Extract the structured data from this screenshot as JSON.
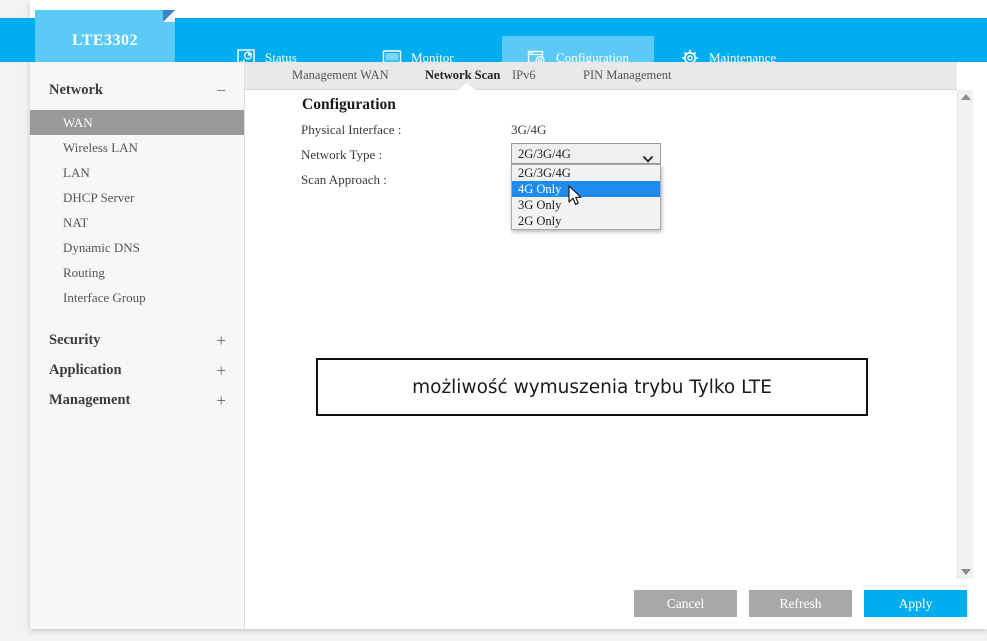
{
  "app": {
    "logo": "LTE3302"
  },
  "topnav": {
    "items": [
      {
        "label": "Status",
        "icon": "status-chart-icon",
        "active": false
      },
      {
        "label": "Monitor",
        "icon": "monitor-screen-icon",
        "active": false
      },
      {
        "label": "Configuration",
        "icon": "window-gear-icon",
        "active": true
      },
      {
        "label": "Maintenance",
        "icon": "gear-icon",
        "active": false
      }
    ]
  },
  "subtabs": {
    "items": [
      {
        "label": "Management WAN",
        "active": false
      },
      {
        "label": "Network Scan",
        "active": true
      },
      {
        "label": "IPv6",
        "active": false
      },
      {
        "label": "PIN Management",
        "active": false
      }
    ]
  },
  "sidebar": {
    "groups": [
      {
        "label": "Network",
        "toggle": "−"
      },
      {
        "label": "Security",
        "toggle": "+"
      },
      {
        "label": "Application",
        "toggle": "+"
      },
      {
        "label": "Management",
        "toggle": "+"
      }
    ],
    "network_items": [
      {
        "label": "WAN",
        "active": true
      },
      {
        "label": "Wireless LAN",
        "active": false
      },
      {
        "label": "LAN",
        "active": false
      },
      {
        "label": "DHCP Server",
        "active": false
      },
      {
        "label": "NAT",
        "active": false
      },
      {
        "label": "Dynamic DNS",
        "active": false
      },
      {
        "label": "Routing",
        "active": false
      },
      {
        "label": "Interface Group",
        "active": false
      }
    ]
  },
  "main": {
    "title": "Configuration",
    "fields": [
      {
        "label": "Physical Interface :",
        "value": "3G/4G"
      },
      {
        "label": "Network Type :",
        "value": "2G/3G/4G"
      },
      {
        "label": "Scan Approach :",
        "value": ""
      }
    ],
    "network_type_select": {
      "selected": "2G/3G/4G",
      "options": [
        {
          "label": "2G/3G/4G",
          "highlighted": false
        },
        {
          "label": "4G Only",
          "highlighted": true
        },
        {
          "label": "3G Only",
          "highlighted": false
        },
        {
          "label": "2G Only",
          "highlighted": false
        }
      ]
    },
    "annotation": "możliwość wymuszenia trybu Tylko LTE"
  },
  "footer": {
    "cancel": "Cancel",
    "refresh": "Refresh",
    "apply": "Apply"
  },
  "colors": {
    "brand_blue": "#00aef0",
    "brand_blue_light": "#5ccaf7",
    "highlight_blue": "#1f8ced",
    "sidebar_active_gray": "#999999",
    "button_gray": "#a8a8a8"
  }
}
